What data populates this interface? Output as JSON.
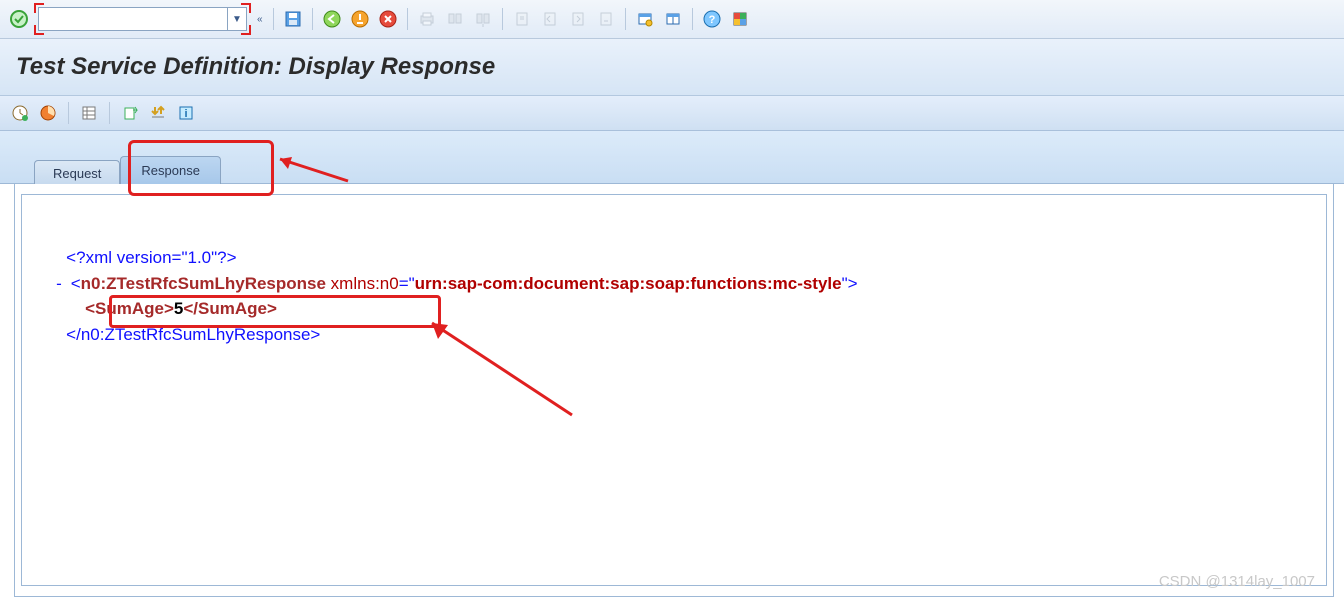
{
  "title": "Test Service Definition: Display Response",
  "tabs": {
    "request": "Request",
    "response": "Response"
  },
  "xml": {
    "decl_open": "<?",
    "decl_body": "xml version=\"1.0\"",
    "decl_close": "?>",
    "root_open_lt": "<",
    "root_name": "n0:ZTestRfcSumLhyResponse",
    "root_ns_attr": " xmlns:n0",
    "root_eq": "=\"",
    "root_ns_val": "urn:sap-com:document:sap:soap:functions:mc-style",
    "root_gt": "\">",
    "child_open": "<SumAge>",
    "child_text": "5",
    "child_close": "</SumAge>",
    "root_close": "</n0:ZTestRfcSumLhyResponse>",
    "collapse_mark": "-"
  },
  "combo": {
    "value": ""
  },
  "watermark": "CSDN @1314lay_1007"
}
